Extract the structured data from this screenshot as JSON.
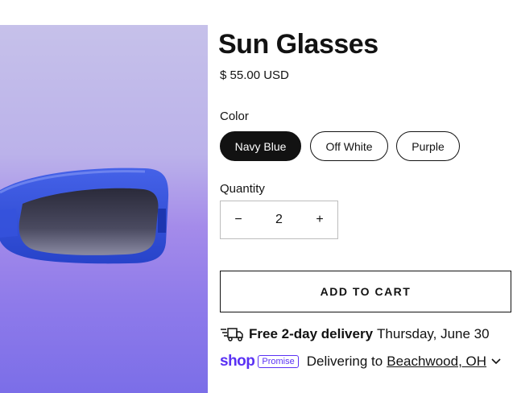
{
  "product": {
    "title": "Sun Glasses",
    "price": "$ 55.00 USD"
  },
  "color": {
    "label": "Color",
    "options": [
      "Navy Blue",
      "Off White",
      "Purple"
    ],
    "selected": "Navy Blue"
  },
  "quantity": {
    "label": "Quantity",
    "value": "2",
    "decrease_symbol": "−",
    "increase_symbol": "+"
  },
  "add_to_cart_label": "ADD TO CART",
  "delivery": {
    "icon": "truck-icon",
    "bold_text": "Free 2-day delivery",
    "date": "Thursday, June 30"
  },
  "shop_promise": {
    "logo": "shop",
    "badge": "Promise",
    "text": "Delivering to",
    "location": "Beachwood, OH"
  },
  "colors": {
    "text": "#121212",
    "shop_brand": "#5a31f4",
    "frame_blue": "#2f4fd6"
  }
}
